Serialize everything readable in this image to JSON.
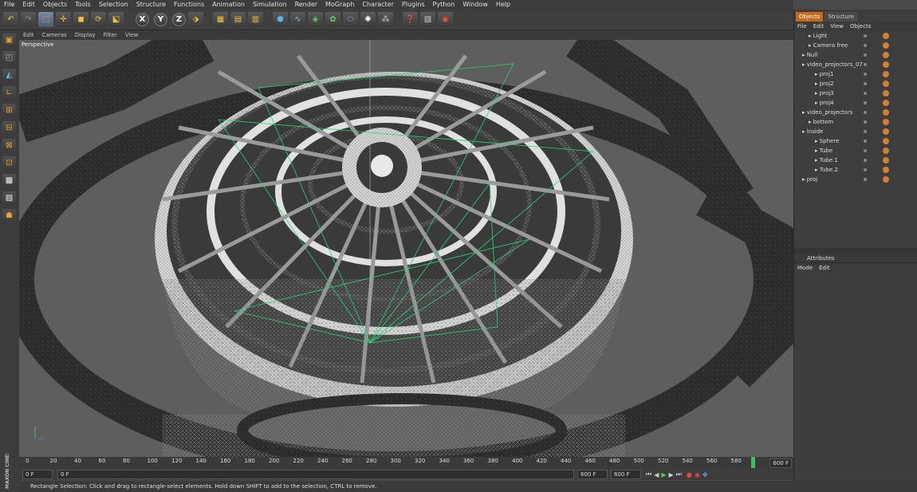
{
  "menu": [
    "File",
    "Edit",
    "Objects",
    "Tools",
    "Selection",
    "Structure",
    "Functions",
    "Animation",
    "Simulation",
    "Render",
    "MoGraph",
    "Character",
    "Plugins",
    "Python",
    "Window",
    "Help"
  ],
  "toolbar": {
    "icons": [
      "undo-icon",
      "redo-icon",
      "select-icon",
      "move-icon",
      "scale-icon",
      "rotate-icon",
      "recent-tool-icon",
      "x-axis",
      "y-axis",
      "z-axis",
      "coordinate-system-icon",
      "render-view-icon",
      "render-picture-viewer-icon",
      "render-settings-icon",
      "cube-icon",
      "spline-icon",
      "nurbs-icon",
      "array-icon",
      "deformer-icon",
      "particle-icon",
      "effector-icon",
      "light-icon",
      "scene-icon",
      "camera-icon"
    ],
    "axis_labels": [
      "X",
      "Y",
      "Z"
    ]
  },
  "viewport": {
    "menu": [
      "Edit",
      "Cameras",
      "Display",
      "Filter",
      "View"
    ],
    "label": "Perspective"
  },
  "timeline": {
    "ticks": [
      "0",
      "20",
      "40",
      "60",
      "80",
      "100",
      "120",
      "140",
      "160",
      "180",
      "200",
      "220",
      "240",
      "260",
      "280",
      "300",
      "320",
      "340",
      "360",
      "380",
      "400",
      "420",
      "440",
      "460",
      "480",
      "500",
      "520",
      "540",
      "560",
      "580"
    ],
    "end_field": "600 F",
    "current_frame": "0 F",
    "start_field": "0 F",
    "max_field": "600 F",
    "min_field": "600 F"
  },
  "status": "Rectangle Selection: Click and drag to rectangle-select elements. Hold down SHIFT to add to the selection, CTRL to remove.",
  "objects_panel": {
    "tabs": [
      "Objects",
      "Structure"
    ],
    "menu": [
      "File",
      "Edit",
      "View",
      "Objects"
    ],
    "items": [
      {
        "name": "Light",
        "indent": 1
      },
      {
        "name": "Camera free",
        "indent": 1
      },
      {
        "name": "Null",
        "indent": 0
      },
      {
        "name": "video_projectors_07",
        "indent": 0
      },
      {
        "name": "proj1",
        "indent": 2
      },
      {
        "name": "proj2",
        "indent": 2
      },
      {
        "name": "proj3",
        "indent": 2
      },
      {
        "name": "proj4",
        "indent": 2
      },
      {
        "name": "video_projectors",
        "indent": 0
      },
      {
        "name": "bottom",
        "indent": 1
      },
      {
        "name": "inside",
        "indent": 0
      },
      {
        "name": "Sphere",
        "indent": 2
      },
      {
        "name": "Tube",
        "indent": 2
      },
      {
        "name": "Tube.1",
        "indent": 2
      },
      {
        "name": "Tube.2",
        "indent": 2
      },
      {
        "name": "proj",
        "indent": 0
      }
    ]
  },
  "attributes_panel": {
    "title": "Attributes",
    "menu": [
      "Mode",
      "Edit"
    ]
  },
  "brand": "MAXON CINEMA 4D"
}
